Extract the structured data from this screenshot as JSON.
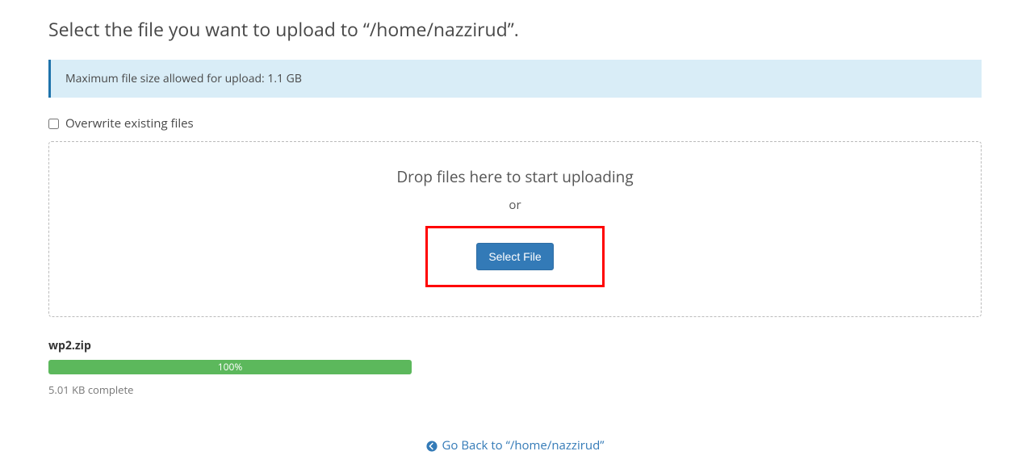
{
  "header": {
    "title": "Select the file you want to upload to “/home/nazzirud”."
  },
  "info": {
    "text": "Maximum file size allowed for upload: 1.1 GB"
  },
  "overwrite": {
    "label": "Overwrite existing files"
  },
  "dropzone": {
    "drop_text": "Drop files here to start uploading",
    "or_text": "or",
    "select_label": "Select File"
  },
  "upload": {
    "filename": "wp2.zip",
    "progress_percent": 100,
    "progress_label": "100%",
    "complete_text": "5.01 KB complete"
  },
  "footer": {
    "go_back_label": "Go Back to “/home/nazzirud”"
  }
}
